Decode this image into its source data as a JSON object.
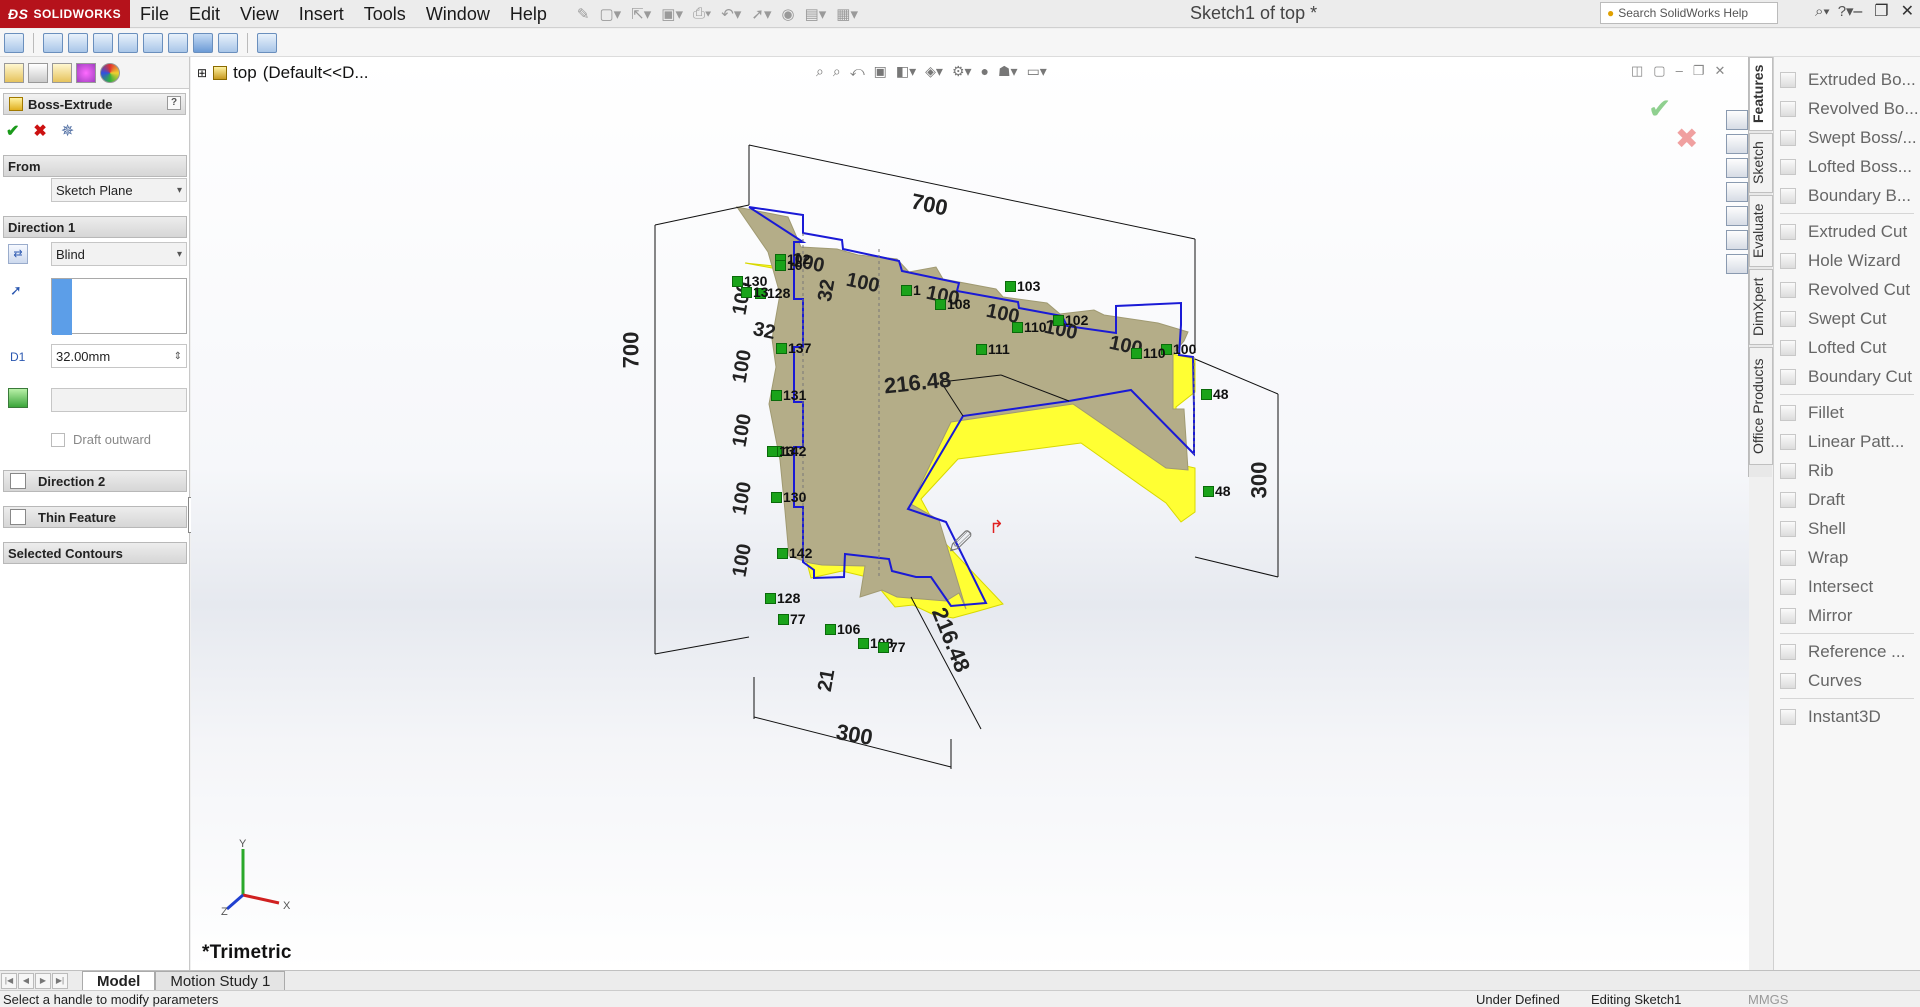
{
  "app": {
    "brand": "SOLIDWORKS",
    "document_title": "Sketch1 of top *",
    "menus": [
      "File",
      "Edit",
      "View",
      "Insert",
      "Tools",
      "Window",
      "Help"
    ],
    "search_placeholder": "Search SolidWorks Help"
  },
  "property_manager": {
    "title": "Boss-Extrude",
    "help": "?",
    "from_label": "From",
    "from_value": "Sketch Plane",
    "direction1_label": "Direction 1",
    "end_condition": "Blind",
    "depth": "32.00mm",
    "draft_outward": "Draft outward",
    "direction2_label": "Direction 2",
    "thin_feature_label": "Thin Feature",
    "selected_contours_label": "Selected Contours"
  },
  "viewport": {
    "tree_part": "top",
    "tree_config": "(Default<<D...",
    "view_orientation": "*Trimetric",
    "triad": {
      "x": "X",
      "y": "Y",
      "z": "Z"
    }
  },
  "sketch": {
    "dimensions": [
      "700",
      "700",
      "300",
      "300",
      "216.48",
      "216.48",
      "100",
      "100",
      "100",
      "100",
      "100",
      "100",
      "100",
      "100",
      "100",
      "100",
      "100",
      "32",
      "32",
      "21"
    ],
    "relations": [
      "102",
      "103",
      "108",
      "102",
      "111",
      "100",
      "48",
      "48",
      "137",
      "131",
      "142",
      "130",
      "142",
      "128",
      "77",
      "106",
      "108",
      "77",
      "130",
      "128",
      "110",
      "110",
      "10",
      "13",
      "13",
      "1"
    ],
    "colors": {
      "face": "#b5ad84",
      "outline": "#1a1ad6",
      "highlight": "#ffff33",
      "relation": "#1aa31a"
    }
  },
  "task_pane_tabs": [
    "Features",
    "Sketch",
    "Evaluate",
    "DimXpert",
    "Office Products"
  ],
  "command_manager": {
    "items": [
      {
        "label": "Extruded Bo...",
        "icon": "extruded-boss-icon"
      },
      {
        "label": "Revolved Bo...",
        "icon": "revolved-boss-icon"
      },
      {
        "label": "Swept Boss/...",
        "icon": "swept-boss-icon"
      },
      {
        "label": "Lofted Boss...",
        "icon": "lofted-boss-icon"
      },
      {
        "label": "Boundary B...",
        "icon": "boundary-boss-icon"
      },
      {
        "label": "Extruded Cut",
        "icon": "extruded-cut-icon"
      },
      {
        "label": "Hole Wizard",
        "icon": "hole-wizard-icon"
      },
      {
        "label": "Revolved Cut",
        "icon": "revolved-cut-icon"
      },
      {
        "label": "Swept Cut",
        "icon": "swept-cut-icon"
      },
      {
        "label": "Lofted Cut",
        "icon": "lofted-cut-icon"
      },
      {
        "label": "Boundary Cut",
        "icon": "boundary-cut-icon"
      },
      {
        "label": "Fillet",
        "icon": "fillet-icon"
      },
      {
        "label": "Linear Patt...",
        "icon": "linear-pattern-icon"
      },
      {
        "label": "Rib",
        "icon": "rib-icon"
      },
      {
        "label": "Draft",
        "icon": "draft-icon"
      },
      {
        "label": "Shell",
        "icon": "shell-icon"
      },
      {
        "label": "Wrap",
        "icon": "wrap-icon"
      },
      {
        "label": "Intersect",
        "icon": "intersect-icon"
      },
      {
        "label": "Mirror",
        "icon": "mirror-icon"
      },
      {
        "label": "Reference ...",
        "icon": "reference-geometry-icon"
      },
      {
        "label": "Curves",
        "icon": "curves-icon"
      },
      {
        "label": "Instant3D",
        "icon": "instant3d-icon"
      }
    ]
  },
  "bottom_tabs": [
    "Model",
    "Motion Study 1"
  ],
  "status": {
    "message": "Select a handle to modify parameters",
    "sketch_state": "Under Defined",
    "editing": "Editing Sketch1",
    "units": "MMGS"
  }
}
